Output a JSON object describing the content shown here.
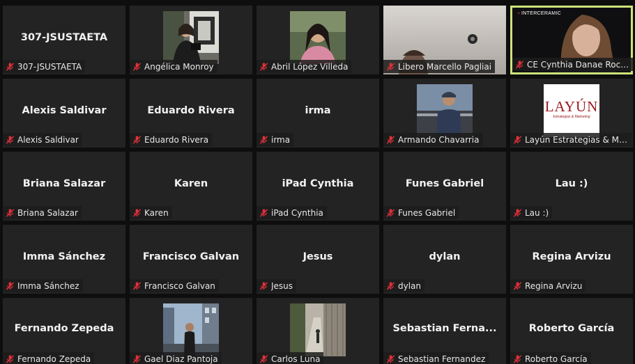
{
  "participants": [
    {
      "id": "p0",
      "display": "307-JSUSTAETA",
      "label": "307-JSUSTAETA",
      "kind": "name"
    },
    {
      "id": "p1",
      "display": "",
      "label": "Angélica Monroy",
      "kind": "photo"
    },
    {
      "id": "p2",
      "display": "",
      "label": "Abril López Villeda",
      "kind": "photo"
    },
    {
      "id": "p3",
      "display": "",
      "label": "Libero Marcello Pagliai",
      "kind": "video"
    },
    {
      "id": "p4",
      "display": "",
      "label": "CE Cynthia Danae Rocha...",
      "kind": "video",
      "active": true,
      "overlay_brand": "INTERCERAMIC"
    },
    {
      "id": "p5",
      "display": "Alexis Saldivar",
      "label": "Alexis Saldivar",
      "kind": "name"
    },
    {
      "id": "p6",
      "display": "Eduardo Rivera",
      "label": "Eduardo Rivera",
      "kind": "name"
    },
    {
      "id": "p7",
      "display": "irma",
      "label": "irma",
      "kind": "name"
    },
    {
      "id": "p8",
      "display": "",
      "label": "Armando Chavarria",
      "kind": "photo"
    },
    {
      "id": "p9",
      "display": "",
      "label": "Layún Estrategias & Ma...",
      "kind": "photo",
      "logo_text": "LAYÚN",
      "logo_sub": "Estrategias & Marketing"
    },
    {
      "id": "p10",
      "display": "Briana Salazar",
      "label": "Briana Salazar",
      "kind": "name"
    },
    {
      "id": "p11",
      "display": "Karen",
      "label": "Karen",
      "kind": "name"
    },
    {
      "id": "p12",
      "display": "iPad Cynthia",
      "label": "iPad Cynthia",
      "kind": "name"
    },
    {
      "id": "p13",
      "display": "Funes Gabriel",
      "label": "Funes Gabriel",
      "kind": "name"
    },
    {
      "id": "p14",
      "display": "Lau :)",
      "label": "Lau :)",
      "kind": "name"
    },
    {
      "id": "p15",
      "display": "Imma Sánchez",
      "label": "Imma Sánchez",
      "kind": "name"
    },
    {
      "id": "p16",
      "display": "Francisco Galvan",
      "label": "Francisco Galvan",
      "kind": "name"
    },
    {
      "id": "p17",
      "display": "Jesus",
      "label": "Jesus",
      "kind": "name"
    },
    {
      "id": "p18",
      "display": "dylan",
      "label": "dylan",
      "kind": "name"
    },
    {
      "id": "p19",
      "display": "Regina Arvizu",
      "label": "Regina Arvizu",
      "kind": "name"
    },
    {
      "id": "p20",
      "display": "Fernando Zepeda",
      "label": "Fernando Zepeda",
      "kind": "name"
    },
    {
      "id": "p21",
      "display": "",
      "label": "Gael Diaz Pantoja",
      "kind": "photo"
    },
    {
      "id": "p22",
      "display": "",
      "label": "Carlos Luna",
      "kind": "photo"
    },
    {
      "id": "p23",
      "display": "Sebastian  Ferna...",
      "label": "Sebastian Fernandez",
      "kind": "name"
    },
    {
      "id": "p24",
      "display": "Roberto García",
      "label": "Roberto García",
      "kind": "name"
    }
  ],
  "colors": {
    "tile_bg": "#232323",
    "active_border": "#cfe37a",
    "muted_mic": "#e0303a",
    "label_text": "#e8e8e8"
  },
  "icons": {
    "mic": "muted-microphone-icon"
  }
}
